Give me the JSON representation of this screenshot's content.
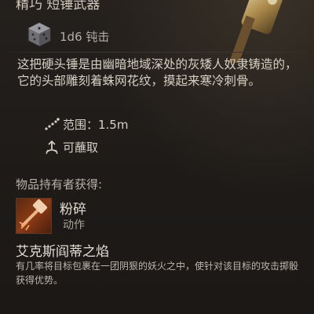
{
  "item": {
    "top_title": "精巧 短锤武器",
    "damage": "1d6 钝击",
    "description": "这把硬头锤是由幽暗地域深处的灰矮人奴隶铸造的，它的头部雕刻着蛛网花纹，摸起来寒冷刺骨。",
    "properties": [
      {
        "icon": "range-icon",
        "text": "范围：1.5m"
      },
      {
        "icon": "dippable-icon",
        "text": "可蘸取"
      }
    ]
  },
  "owner_section": {
    "title": "物品持有者获得:",
    "action": {
      "icon": "smash-action-icon",
      "name": "粉碎",
      "type": "动作"
    },
    "feature": {
      "title": "艾克斯阎蒂之焰",
      "description": "有几率将目标包裹在一团阴狠的妖火之中，使针对该目标的攻击掷骰获得优势。"
    }
  },
  "colors": {
    "background": "#1d1a18",
    "text": "#d6d0c4",
    "muted": "#a8a196",
    "accent_orange": "#c9541f"
  }
}
